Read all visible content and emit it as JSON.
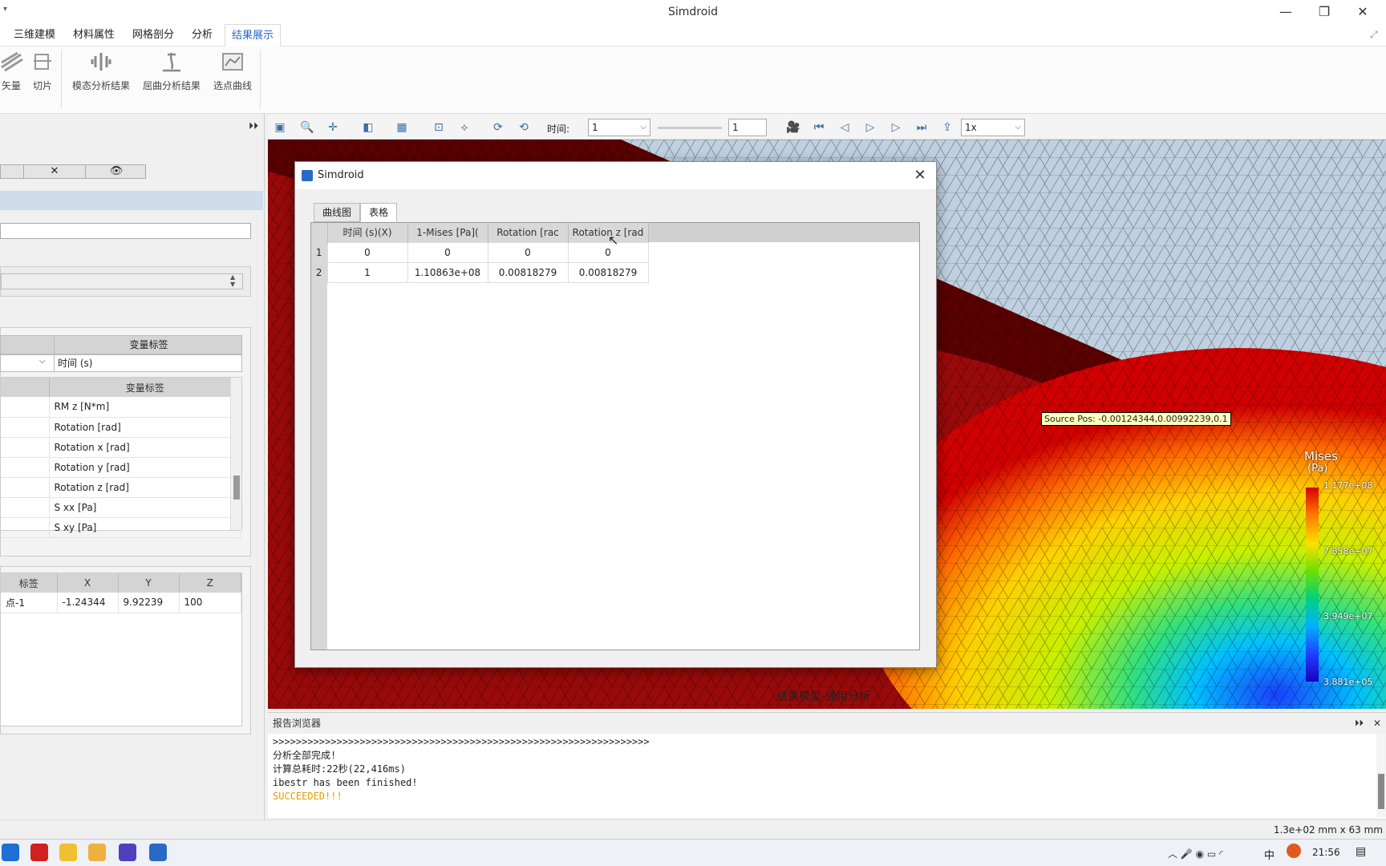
{
  "app": {
    "title": "Simdroid",
    "min": "—",
    "restore": "❐",
    "close": "✕"
  },
  "menu": {
    "tabs": [
      "三维建模",
      "材料属性",
      "网格剖分",
      "分析",
      "结果展示"
    ],
    "active": 4
  },
  "ribbon": {
    "buttons": [
      "矢量",
      "切片",
      "模态分析结果",
      "屈曲分析结果",
      "选点曲线"
    ]
  },
  "vtoolbar": {
    "time_label": "时间:",
    "time_value": "1",
    "spin_value": "1",
    "speed": "1x"
  },
  "leftpanel": {
    "var_header": "变量标签",
    "var_select": "时间 (s)",
    "var_list_header": "变量标签",
    "var_list": [
      "RM z [N*m]",
      "Rotation  [rad]",
      "Rotation x [rad]",
      "Rotation y [rad]",
      "Rotation z [rad]",
      "S xx [Pa]",
      "S xy [Pa]"
    ],
    "point_headers": [
      "标签",
      "X",
      "Y",
      "Z"
    ],
    "point_rows": [
      [
        "点-1",
        "-1.24344",
        "9.92239",
        "100"
      ]
    ]
  },
  "dialog": {
    "title": "Simdroid",
    "tabs": [
      "曲线图",
      "表格"
    ],
    "active_tab": 1,
    "headers": [
      "时间 (s)(X)",
      "1-Mises [Pa](",
      "Rotation  [rac",
      "Rotation z [rad"
    ],
    "rows": [
      [
        "1",
        "0",
        "0",
        "0",
        "0"
      ],
      [
        "2",
        "1",
        "1.10863e+08",
        "0.00818279",
        "0.00818279"
      ]
    ]
  },
  "viewport": {
    "source_pos": "Source Pos: -0.00124344,0.00992239,0.1",
    "legend_title": "Mises",
    "legend_unit": "(Pa)",
    "legend_values": [
      "1.177e+08",
      "7.858e+07",
      "3.949e+07",
      "3.881e+05"
    ],
    "model_label": "结果模型-通用分析"
  },
  "report": {
    "title": "报告浏览器",
    "lines": [
      ">>>>>>>>>>>>>>>>>>>>>>>>>>>>>>>>>>>>>>>>>>>>>>>>>>>>>>>>>>>>>>>>>",
      "分析全部完成!",
      "计算总耗时:22秒(22,416ms)",
      "ibestr has been finished!",
      "SUCCEEDED!!!"
    ]
  },
  "status": {
    "scale": "1.3e+02 mm x 63 mm"
  },
  "taskbar": {
    "time": "21:56",
    "lang": "中"
  },
  "colors": {
    "accent": "#2a6ac7",
    "success": "#e0a000"
  }
}
